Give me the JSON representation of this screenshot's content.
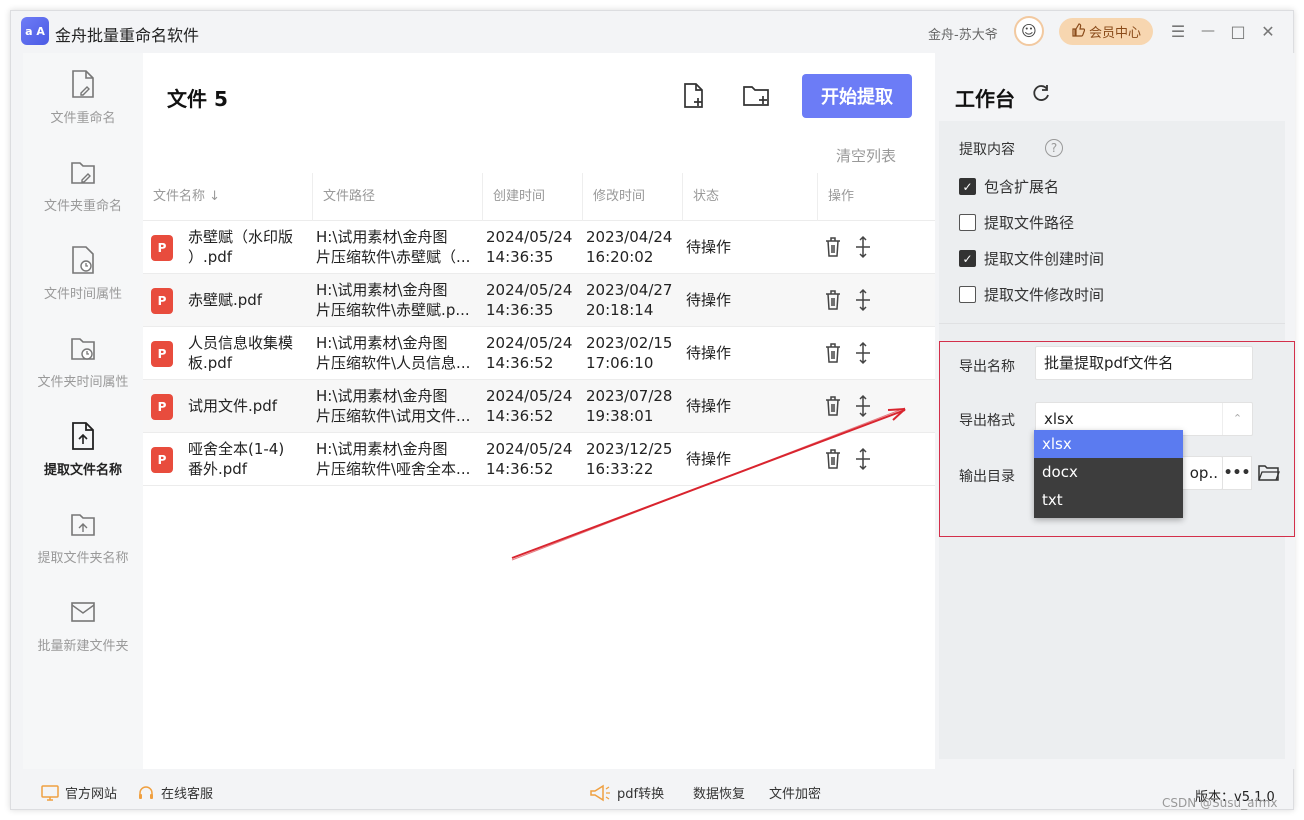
{
  "app": {
    "logo_text": "a A",
    "title": "金舟批量重命名软件",
    "user_name": "金舟-苏大爷",
    "avatar_glyph": "☺",
    "vip_label": "会员中心",
    "win_min": "—",
    "win_max": "□",
    "win_close": "✕",
    "menu_glyph": "☰"
  },
  "sidebar": {
    "items": [
      {
        "label": "文件重命名",
        "icon": "file-edit-icon"
      },
      {
        "label": "文件夹重命名",
        "icon": "folder-edit-icon"
      },
      {
        "label": "文件时间属性",
        "icon": "file-clock-icon"
      },
      {
        "label": "文件夹时间属性",
        "icon": "folder-clock-icon"
      },
      {
        "label": "提取文件名称",
        "icon": "file-upload-icon"
      },
      {
        "label": "提取文件夹名称",
        "icon": "folder-upload-icon"
      },
      {
        "label": "批量新建文件夹",
        "icon": "mail-folder-icon"
      }
    ]
  },
  "main": {
    "title": "文件 5",
    "start_label": "开始提取",
    "clear_label": "清空列表",
    "columns": [
      "文件名称",
      "文件路径",
      "创建时间",
      "修改时间",
      "状态",
      "操作"
    ],
    "sort_glyph": "↓",
    "pdf_glyph": "P",
    "rows": [
      {
        "name1": "赤壁赋（水印版",
        "name2": "）.pdf",
        "path1": "H:\\试用素材\\金舟图",
        "path2": "片压缩软件\\赤壁赋（...",
        "c1": "2024/05/24",
        "c2": "14:36:35",
        "m1": "2023/04/24",
        "m2": "16:20:02",
        "status": "待操作"
      },
      {
        "name1": "赤壁赋.pdf",
        "name2": "",
        "path1": "H:\\试用素材\\金舟图",
        "path2": "片压缩软件\\赤壁赋.p...",
        "c1": "2024/05/24",
        "c2": "14:36:35",
        "m1": "2023/04/27",
        "m2": "20:18:14",
        "status": "待操作"
      },
      {
        "name1": "人员信息收集模",
        "name2": "板.pdf",
        "path1": "H:\\试用素材\\金舟图",
        "path2": "片压缩软件\\人员信息...",
        "c1": "2024/05/24",
        "c2": "14:36:52",
        "m1": "2023/02/15",
        "m2": "17:06:10",
        "status": "待操作"
      },
      {
        "name1": "试用文件.pdf",
        "name2": "",
        "path1": "H:\\试用素材\\金舟图",
        "path2": "片压缩软件\\试用文件...",
        "c1": "2024/05/24",
        "c2": "14:36:52",
        "m1": "2023/07/28",
        "m2": "19:38:01",
        "status": "待操作"
      },
      {
        "name1": "哑舍全本(1-4)",
        "name2": "番外.pdf",
        "path1": "H:\\试用素材\\金舟图",
        "path2": "片压缩软件\\哑舍全本...",
        "c1": "2024/05/24",
        "c2": "14:36:52",
        "m1": "2023/12/25",
        "m2": "16:33:22",
        "status": "待操作"
      }
    ]
  },
  "workbench": {
    "title": "工作台",
    "extract_label": "提取内容",
    "help_glyph": "?",
    "check_glyph": "✓",
    "options": [
      {
        "label": "包含扩展名",
        "checked": true
      },
      {
        "label": "提取文件路径",
        "checked": false
      },
      {
        "label": "提取文件创建时间",
        "checked": true
      },
      {
        "label": "提取文件修改时间",
        "checked": false
      }
    ],
    "export_name_label": "导出名称",
    "export_name_value": "批量提取pdf文件名",
    "export_format_label": "导出格式",
    "export_format_value": "xlsx",
    "select_arrow": "⌃",
    "output_dir_label": "输出目录",
    "output_dir_value": "op..",
    "dots": "•••",
    "format_options": [
      "xlsx",
      "docx",
      "txt"
    ]
  },
  "footer": {
    "official_site": "官方网站",
    "online_service": "在线客服",
    "pdf_convert": "pdf转换",
    "data_recovery": "数据恢复",
    "file_encrypt": "文件加密",
    "version": "版本：v5.1.0"
  },
  "watermark": "CSDN @Susu_afmx",
  "colors": {
    "accent": "#6c7cf6",
    "highlight_border": "#d32f4a",
    "pdf_red": "#e84c3d",
    "annotation_arrow": "#d9252f"
  }
}
